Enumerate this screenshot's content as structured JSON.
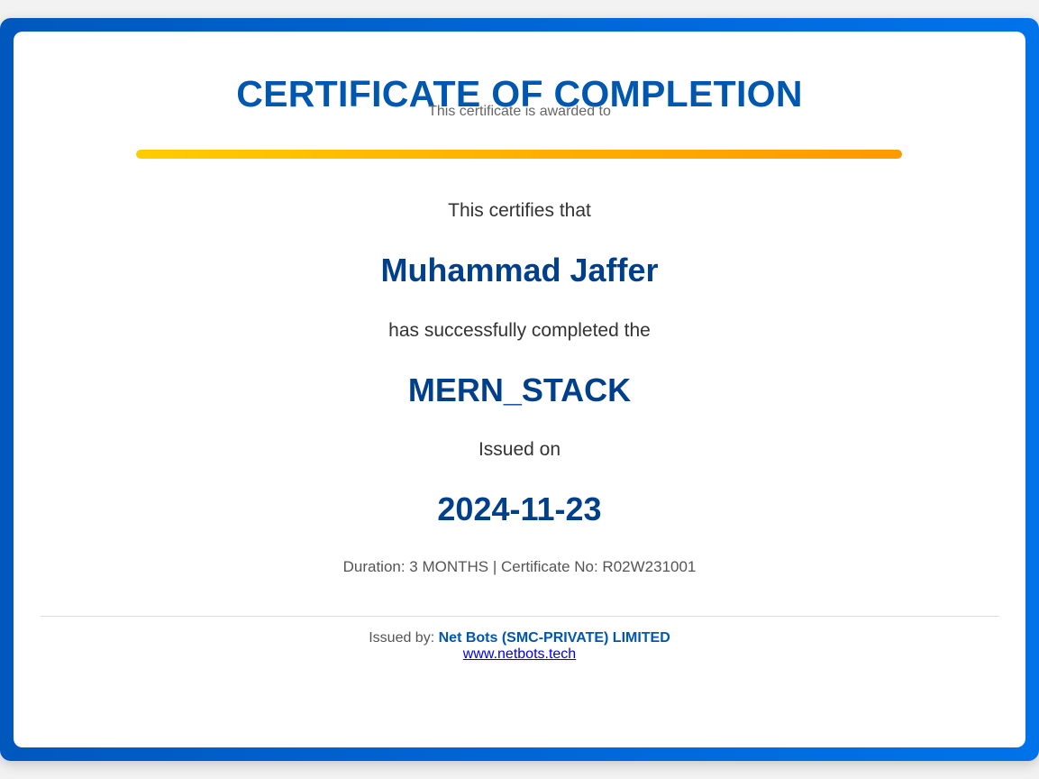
{
  "certificate": {
    "title": "CERTIFICATE OF COMPLETION",
    "subtitle": "This certificate is awarded to",
    "certifies_text": "This certifies that",
    "recipient_name": "Muhammad Jaffer",
    "completed_text": "has successfully completed the",
    "course_name": "MERN_STACK",
    "issued_on_label": "Issued on",
    "issue_date": "2024-11-23",
    "details": "Duration: 3 MONTHS | Certificate No: R02W231001",
    "issued_by_label": "Issued by:",
    "issuer_name": "Net Bots (SMC-PRIVATE) LIMITED",
    "website": "www.netbots.tech"
  },
  "colors": {
    "frame_blue": "#0066d6",
    "title_blue": "#0057b0",
    "emphasis_blue": "#003f8c",
    "accent_bar_start": "#ffcc00",
    "accent_bar_end": "#ff9900"
  }
}
